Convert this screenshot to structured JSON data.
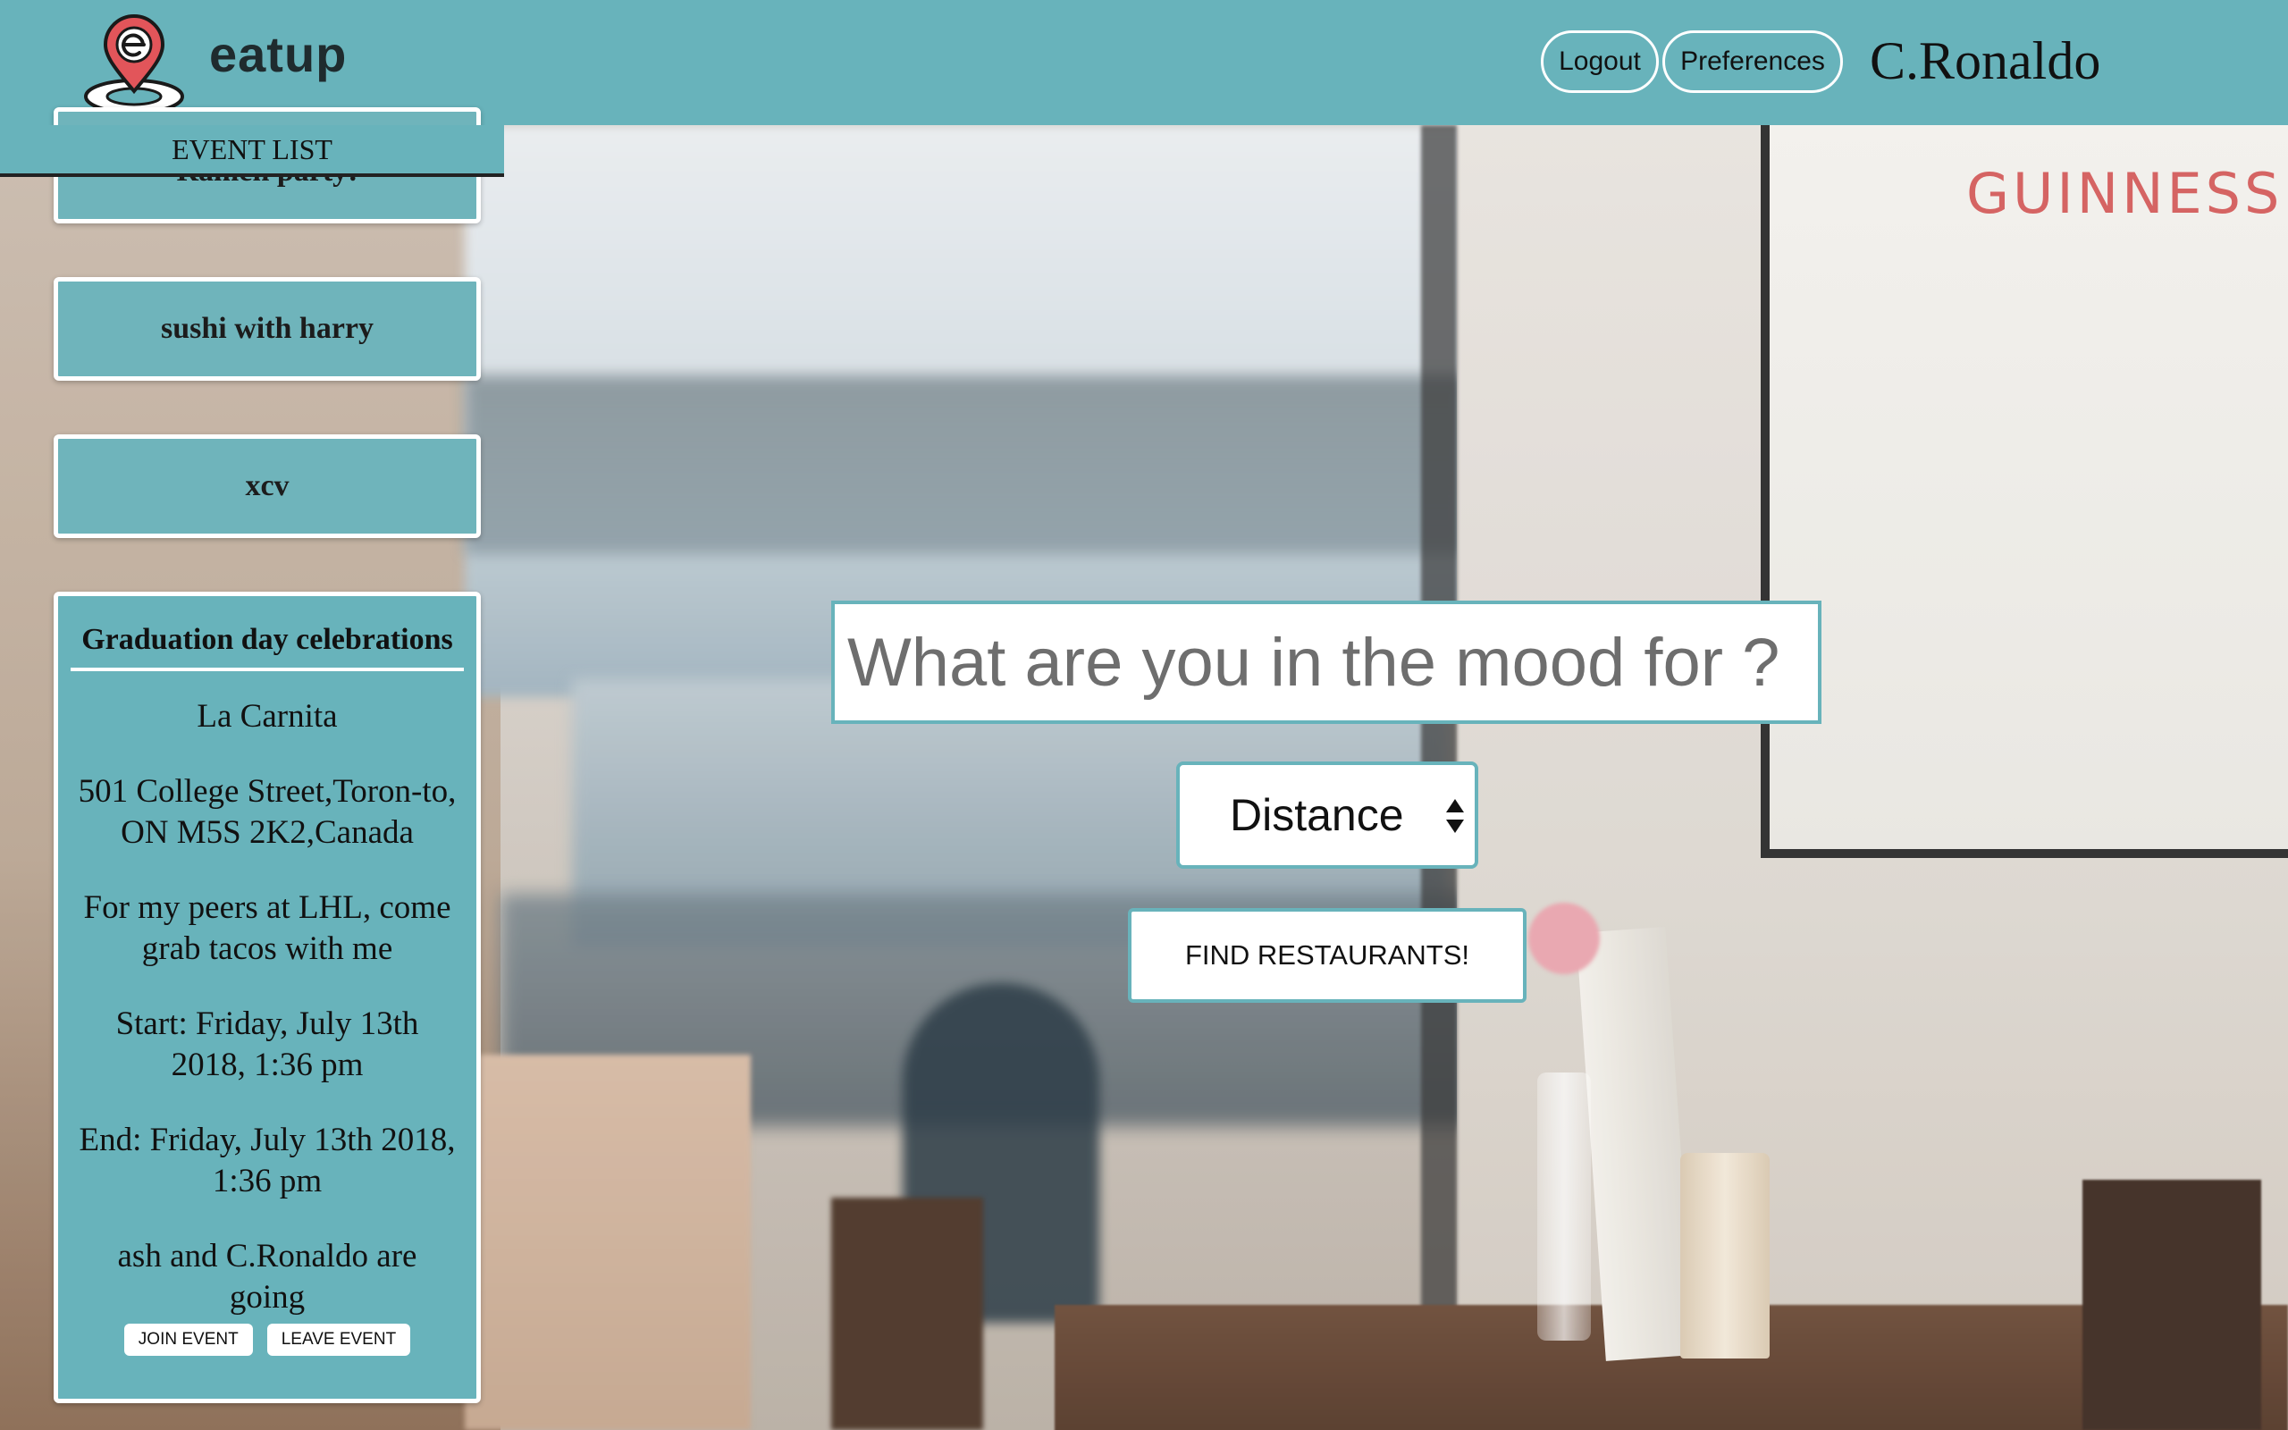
{
  "header": {
    "brand": "eatup",
    "logout_label": "Logout",
    "preferences_label": "Preferences",
    "username": "C.Ronaldo"
  },
  "background": {
    "poster_text": "GUINNESS"
  },
  "event_list": {
    "title": "EVENT LIST",
    "events": [
      {
        "name": "Ramen party!"
      },
      {
        "name": "sushi with harry"
      },
      {
        "name": "xcv"
      }
    ],
    "selected": {
      "name": "Graduation day celebrations",
      "restaurant": "La Carnita",
      "address": "501 College Street,Toron-to, ON M5S 2K2,Canada",
      "description": "For my peers at LHL, come grab tacos with me",
      "start": "Start: Friday, July 13th 2018, 1:36 pm",
      "end": "End: Friday, July 13th 2018, 1:36 pm",
      "attendees": "ash and C.Ronaldo are going",
      "join_label": "JOIN EVENT",
      "leave_label": "LEAVE EVENT"
    }
  },
  "search": {
    "placeholder": "What are you in the mood for ?",
    "distance_label": "Distance",
    "find_label": "FIND RESTAURANTS!"
  },
  "colors": {
    "accent": "#68b3bb",
    "logo_pin": "#e2555a"
  }
}
